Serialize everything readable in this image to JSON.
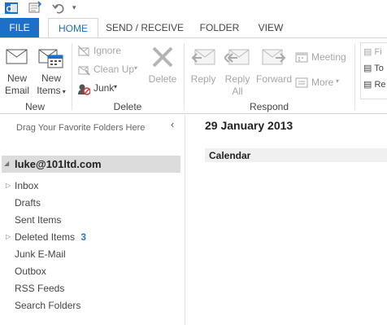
{
  "tabs": [
    "FILE",
    "HOME",
    "SEND / RECEIVE",
    "FOLDER",
    "VIEW"
  ],
  "ribbon": {
    "new_group": {
      "new_email": [
        "New",
        "Email"
      ],
      "new_items": [
        "New",
        "Items"
      ],
      "label": "New"
    },
    "delete_group": {
      "ignore": "Ignore",
      "clean_up": "Clean Up",
      "junk": "Junk",
      "delete": "Delete",
      "label": "Delete"
    },
    "respond_group": {
      "reply": "Reply",
      "reply_all": [
        "Reply",
        "All"
      ],
      "forward": "Forward",
      "meeting": "Meeting",
      "more": "More",
      "label": "Respond"
    },
    "partial": {
      "fi": "Fi",
      "to": "To",
      "re": "Re"
    }
  },
  "folder_pane": {
    "drag_hint": "Drag Your Favorite Folders Here",
    "account": "luke@101ltd.com",
    "folders": [
      {
        "name": "Inbox"
      },
      {
        "name": "Drafts"
      },
      {
        "name": "Sent Items"
      },
      {
        "name": "Deleted Items",
        "count": "3"
      },
      {
        "name": "Junk E-Mail"
      },
      {
        "name": "Outbox"
      },
      {
        "name": "RSS Feeds"
      },
      {
        "name": "Search Folders"
      }
    ]
  },
  "main": {
    "date": "29 January 2013",
    "calendar_label": "Calendar"
  },
  "colors": {
    "accent": "#1e6fc8",
    "count": "#2a7ac8"
  }
}
